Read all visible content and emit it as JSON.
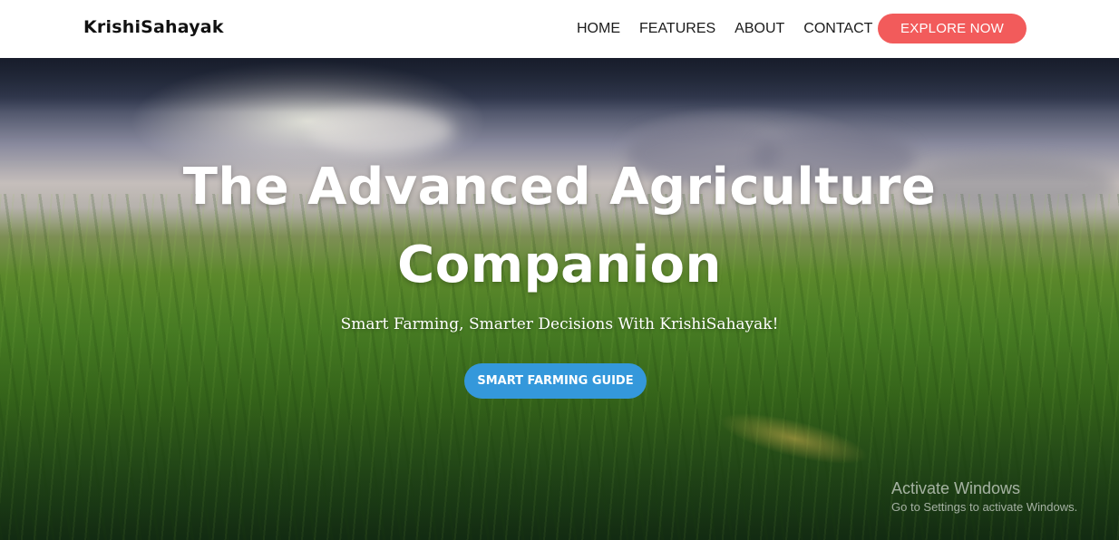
{
  "navbar": {
    "brand": "KrishiSahayak",
    "links": [
      "HOME",
      "FEATURES",
      "ABOUT",
      "CONTACT"
    ],
    "cta_label": "EXPLORE NOW",
    "cta_color": "#f25b5b"
  },
  "hero": {
    "title_line1": "The Advanced Agriculture",
    "title_line2": "Companion",
    "subtitle": "Smart Farming, Smarter Decisions With KrishiSahayak!",
    "button_label": "SMART FARMING GUIDE",
    "button_color": "#3498db",
    "background_image": "grass-field-under-cloudy-sky"
  },
  "os_watermark": {
    "title": "Activate Windows",
    "subtitle": "Go to Settings to activate Windows."
  }
}
